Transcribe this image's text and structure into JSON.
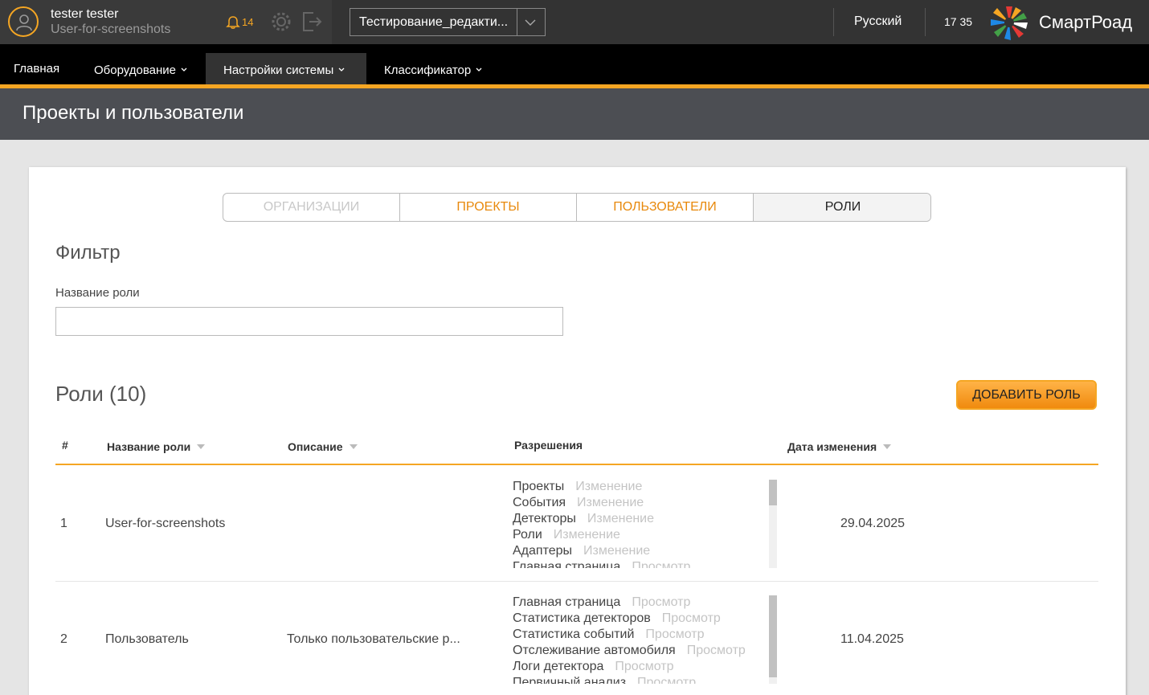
{
  "user": {
    "name": "tester tester",
    "login": "User-for-screenshots"
  },
  "notifications": {
    "count": "14"
  },
  "project_select": {
    "value": "Тестирование_редакти..."
  },
  "language": "Русский",
  "clock": "17 35",
  "brand": "СмартРоад",
  "nav": [
    {
      "label": "Главная",
      "has_caret": false
    },
    {
      "label": "Оборудование",
      "has_caret": true
    },
    {
      "label": "Настройки системы",
      "has_caret": true,
      "active": true
    },
    {
      "label": "Классификатор",
      "has_caret": true
    }
  ],
  "page_title": "Проекты и пользователи",
  "tabs": [
    {
      "label": "ОРГАНИЗАЦИИ",
      "state": "disabled"
    },
    {
      "label": "ПРОЕКТЫ",
      "state": "link"
    },
    {
      "label": "ПОЛЬЗОВАТЕЛИ",
      "state": "link"
    },
    {
      "label": "РОЛИ",
      "state": "active"
    }
  ],
  "filter": {
    "title": "Фильтр",
    "role_name_label": "Название роли",
    "role_name_value": ""
  },
  "roles": {
    "title": "Роли (10)",
    "add_button": "ДОБАВИТЬ РОЛЬ",
    "columns": [
      "#",
      "Название роли",
      "Описание",
      "Разрешения",
      "Дата изменения"
    ],
    "rows": [
      {
        "num": "1",
        "name": "User-for-screenshots",
        "description": "",
        "permissions": [
          {
            "object": "Проекты",
            "access": "Изменение"
          },
          {
            "object": "События",
            "access": "Изменение"
          },
          {
            "object": "Детекторы",
            "access": "Изменение"
          },
          {
            "object": "Роли",
            "access": "Изменение"
          },
          {
            "object": "Адаптеры",
            "access": "Изменение"
          },
          {
            "object": "Главная страница",
            "access": "Просмотр"
          }
        ],
        "date": "29.04.2025"
      },
      {
        "num": "2",
        "name": "Пользователь",
        "description": "Только пользовательские р...",
        "permissions": [
          {
            "object": "Главная страница",
            "access": "Просмотр"
          },
          {
            "object": "Статистика детекторов",
            "access": "Просмотр"
          },
          {
            "object": "Статистика событий",
            "access": "Просмотр"
          },
          {
            "object": "Отслеживание автомобиля",
            "access": "Просмотр"
          },
          {
            "object": "Логи детектора",
            "access": "Просмотр"
          },
          {
            "object": "Первичный анализ",
            "access": "Просмотр"
          }
        ],
        "date": "11.04.2025"
      }
    ]
  },
  "colors": {
    "accent": "#f5a623",
    "topbar": "#333333",
    "nav": "#000000",
    "header": "#4c4e53"
  }
}
